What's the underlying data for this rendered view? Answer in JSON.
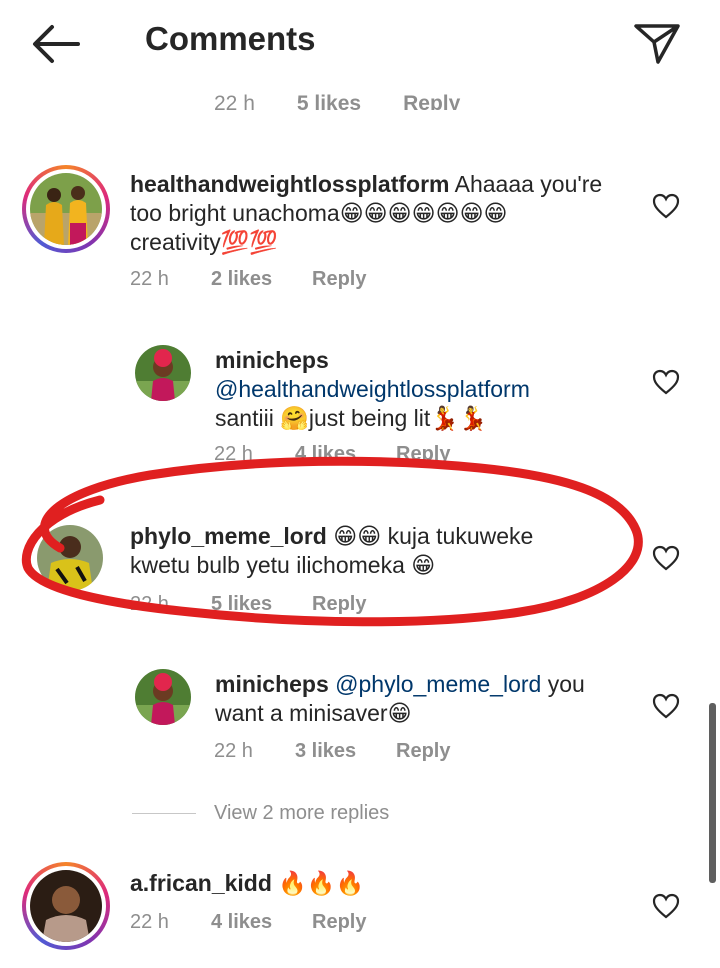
{
  "header": {
    "title": "Comments",
    "back_icon": "arrow-left-icon",
    "share_icon": "paper-plane-icon"
  },
  "clipped_top": {
    "time": "22 h",
    "likes": "5 likes",
    "reply": "Reply"
  },
  "comments": [
    {
      "username": "healthandweightlossplatform",
      "body_line1": "Ahaaaa you're",
      "body_line2": "too bright unachoma😁😁😁😁😁😁😁",
      "body_line3": "creativity💯💯",
      "time": "22 h",
      "likes": "2 likes",
      "reply": "Reply"
    },
    {
      "username": "minicheps",
      "mention": "@healthandweightlossplatform",
      "body": "santiii 🤗just being lit💃💃",
      "time": "22 h",
      "likes": "4 likes",
      "reply": "Reply"
    },
    {
      "username": "phylo_meme_lord",
      "body_line1": "😁😁 kuja tukuweke",
      "body_line2": "kwetu bulb yetu ilichomeka 😁",
      "time": "22 h",
      "likes": "5 likes",
      "reply": "Reply"
    },
    {
      "username": "minicheps",
      "mention": "@phylo_meme_lord",
      "body_line1": " you",
      "body_line2": "want a minisaver😁",
      "time": "22 h",
      "likes": "3 likes",
      "reply": "Reply"
    },
    {
      "username": "a.frican_kidd",
      "body": "🔥🔥🔥",
      "time": "22 h",
      "likes": "4 likes",
      "reply": "Reply"
    }
  ],
  "view_more": "View 2 more replies",
  "colors": {
    "annotation": "#e02020",
    "mention": "#00376b",
    "muted": "#8e8e8e"
  }
}
